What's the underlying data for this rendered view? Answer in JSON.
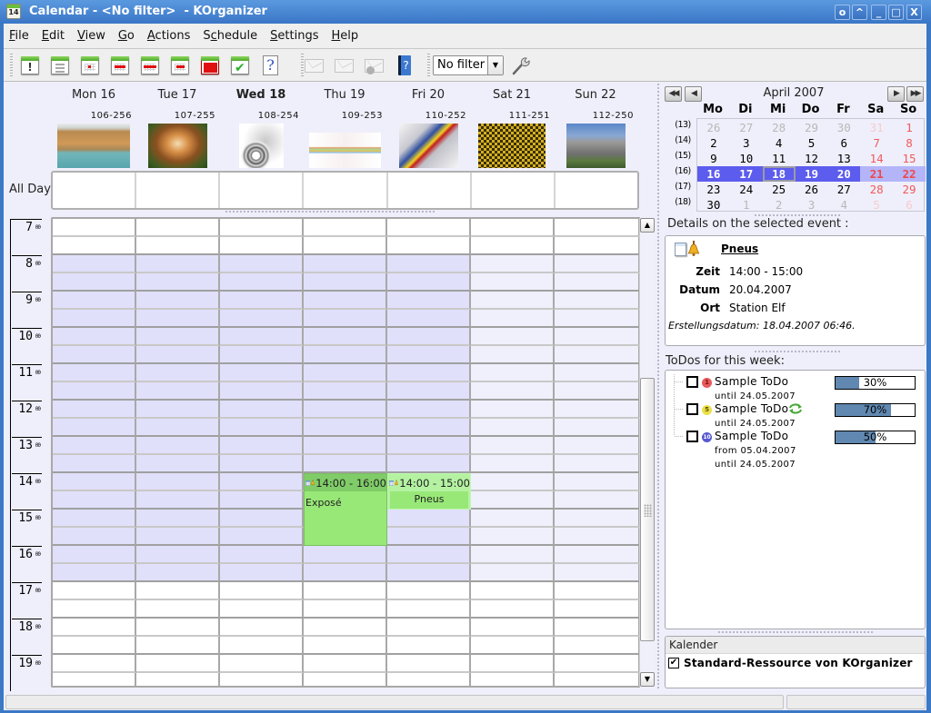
{
  "window": {
    "title": "Calendar - <No filter>  - KOrganizer",
    "app_icon_text": "14",
    "buttons": [
      {
        "name": "window-menu-button",
        "glyph": "o"
      },
      {
        "name": "shade-button",
        "glyph": "^"
      },
      {
        "name": "minimize-button",
        "glyph": "_"
      },
      {
        "name": "maximize-button",
        "glyph": "□"
      },
      {
        "name": "close-button",
        "glyph": "X"
      }
    ]
  },
  "menu": [
    {
      "label": "File",
      "mnemonic": 0
    },
    {
      "label": "Edit",
      "mnemonic": 0
    },
    {
      "label": "View",
      "mnemonic": 0
    },
    {
      "label": "Go",
      "mnemonic": 0
    },
    {
      "label": "Actions",
      "mnemonic": 0
    },
    {
      "label": "Schedule",
      "mnemonic": 1
    },
    {
      "label": "Settings",
      "mnemonic": 0
    },
    {
      "label": "Help",
      "mnemonic": 0
    }
  ],
  "toolbar": {
    "views": [
      {
        "icon": "whats-next",
        "enabled": true
      },
      {
        "icon": "list-view",
        "enabled": true
      },
      {
        "icon": "day-view",
        "enabled": true
      },
      {
        "icon": "work-week-view",
        "enabled": true
      },
      {
        "icon": "week-view",
        "enabled": true
      },
      {
        "icon": "next-days-view",
        "enabled": true
      },
      {
        "icon": "month-view",
        "enabled": true
      },
      {
        "icon": "todo-view",
        "enabled": true
      },
      {
        "icon": "journal-view",
        "enabled": true
      }
    ],
    "actions": [
      {
        "icon": "send-invitation",
        "enabled": false
      },
      {
        "icon": "mail-free-busy",
        "enabled": false
      },
      {
        "icon": "upload-free-busy",
        "enabled": false
      },
      {
        "icon": "whats-this",
        "enabled": true
      }
    ],
    "filter": {
      "value": "No filter",
      "arrow": "▼"
    },
    "manage_filters_icon": "wrench"
  },
  "agenda": {
    "days": [
      {
        "label": "Mon 16",
        "day_numbers": "106-256",
        "picture": "mosquito-larvae",
        "today": false
      },
      {
        "label": "Tue 17",
        "day_numbers": "107-255",
        "picture": "tiger",
        "today": false
      },
      {
        "label": "Wed 18",
        "day_numbers": "108-254",
        "picture": "lorenz-attractor",
        "today": true
      },
      {
        "label": "Thu 19",
        "day_numbers": "109-253",
        "picture": "dna-diagram",
        "today": false
      },
      {
        "label": "Fri 20",
        "day_numbers": "110-252",
        "picture": "rally-car",
        "today": false
      },
      {
        "label": "Sat 21",
        "day_numbers": "111-251",
        "picture": "golden-pattern",
        "today": false
      },
      {
        "label": "Sun 22",
        "day_numbers": "112-250",
        "picture": "castle",
        "today": false
      }
    ],
    "all_day_label": "All Day",
    "first_hour": 7,
    "hours": [
      "7",
      "8",
      "9",
      "10",
      "11",
      "12",
      "13",
      "14",
      "15",
      "16",
      "17",
      "18",
      "19"
    ],
    "hour_suffix": "00",
    "work_hours": {
      "start": 8,
      "end": 17
    },
    "work_days": [
      0,
      1,
      2,
      3,
      4
    ],
    "events": [
      {
        "title": "Exposé",
        "day": 3,
        "start": 14,
        "end": 16,
        "time": "14:00 - 16:00",
        "icons": [
          "calendar-icon",
          "bell-icon"
        ],
        "selected": false
      },
      {
        "title": "Pneus",
        "day": 4,
        "start": 14,
        "end": 15,
        "time": "14:00 - 15:00",
        "icons": [
          "calendar-icon",
          "bell-icon"
        ],
        "selected": true
      }
    ],
    "scroll": {
      "position": 0.33,
      "visible_fraction": 0.6
    }
  },
  "navigator": {
    "month_label": "April 2007",
    "buttons": {
      "prev_year": "◀◀",
      "prev_month": "◀",
      "next_month": "▶",
      "next_year": "▶▶"
    },
    "weekdays": [
      "Mo",
      "Di",
      "Mi",
      "Do",
      "Fr",
      "Sa",
      "So"
    ],
    "weeks": [
      {
        "week": "(13)",
        "days": [
          {
            "d": "26",
            "out": true
          },
          {
            "d": "27",
            "out": true
          },
          {
            "d": "28",
            "out": true
          },
          {
            "d": "29",
            "out": true
          },
          {
            "d": "30",
            "out": true
          },
          {
            "d": "31",
            "out": true
          },
          {
            "d": "1",
            "out": false
          }
        ]
      },
      {
        "week": "(14)",
        "days": [
          {
            "d": "2"
          },
          {
            "d": "3"
          },
          {
            "d": "4"
          },
          {
            "d": "5"
          },
          {
            "d": "6"
          },
          {
            "d": "7"
          },
          {
            "d": "8"
          }
        ]
      },
      {
        "week": "(15)",
        "days": [
          {
            "d": "9"
          },
          {
            "d": "10"
          },
          {
            "d": "11"
          },
          {
            "d": "12"
          },
          {
            "d": "13"
          },
          {
            "d": "14"
          },
          {
            "d": "15"
          }
        ]
      },
      {
        "week": "(16)",
        "days": [
          {
            "d": "16"
          },
          {
            "d": "17"
          },
          {
            "d": "18"
          },
          {
            "d": "19"
          },
          {
            "d": "20"
          },
          {
            "d": "21"
          },
          {
            "d": "22"
          }
        ]
      },
      {
        "week": "(17)",
        "days": [
          {
            "d": "23"
          },
          {
            "d": "24"
          },
          {
            "d": "25"
          },
          {
            "d": "26"
          },
          {
            "d": "27"
          },
          {
            "d": "28"
          },
          {
            "d": "29"
          }
        ]
      },
      {
        "week": "(18)",
        "days": [
          {
            "d": "30"
          },
          {
            "d": "1",
            "out": true
          },
          {
            "d": "2",
            "out": true
          },
          {
            "d": "3",
            "out": true
          },
          {
            "d": "4",
            "out": true
          },
          {
            "d": "5",
            "out": true
          },
          {
            "d": "6",
            "out": true
          }
        ]
      }
    ],
    "selected_week": 3,
    "today": {
      "week": 3,
      "day": 2
    }
  },
  "details": {
    "heading": "Details on the selected event :",
    "title": "Pneus",
    "fields": [
      {
        "label": "Zeit",
        "value": "14:00 - 15:00"
      },
      {
        "label": "Datum",
        "value": "20.04.2007"
      },
      {
        "label": "Ort",
        "value": "Station Elf"
      }
    ],
    "created": "Erstellungsdatum: 18.04.2007 06:46."
  },
  "todos": {
    "heading": "ToDos for this week:",
    "items": [
      {
        "title": "Sample ToDo",
        "priority": "1",
        "priority_color": "#e85a5a",
        "done": false,
        "percent": 30,
        "percent_label": "30%",
        "recurring": false,
        "lines": [
          "until 24.05.2007"
        ]
      },
      {
        "title": "Sample ToDo",
        "priority": "5",
        "priority_color": "#ece048",
        "done": false,
        "percent": 70,
        "percent_label": "70%",
        "recurring": true,
        "lines": [
          "until 24.05.2007"
        ]
      },
      {
        "title": "Sample ToDo",
        "priority": "10",
        "priority_color": "#5858d0",
        "done": false,
        "percent": 50,
        "percent_label": "50%",
        "recurring": false,
        "lines": [
          "from 05.04.2007",
          "until 24.05.2007"
        ]
      }
    ]
  },
  "calendars": {
    "header": "Kalender",
    "items": [
      {
        "label": "Standard-Ressource von KOrganizer",
        "checked": true
      }
    ]
  },
  "statusbar": {
    "left": "",
    "right": ""
  },
  "colors": {
    "event": "#98e878",
    "event_header": "#80cc68",
    "event_selected_header": "#b4f2a2",
    "work_hours": "#e0e0fa",
    "weekend_work_hours": "#f0f0fc",
    "off_hours": "#ffffff",
    "todo_progress": "#6088b0"
  }
}
